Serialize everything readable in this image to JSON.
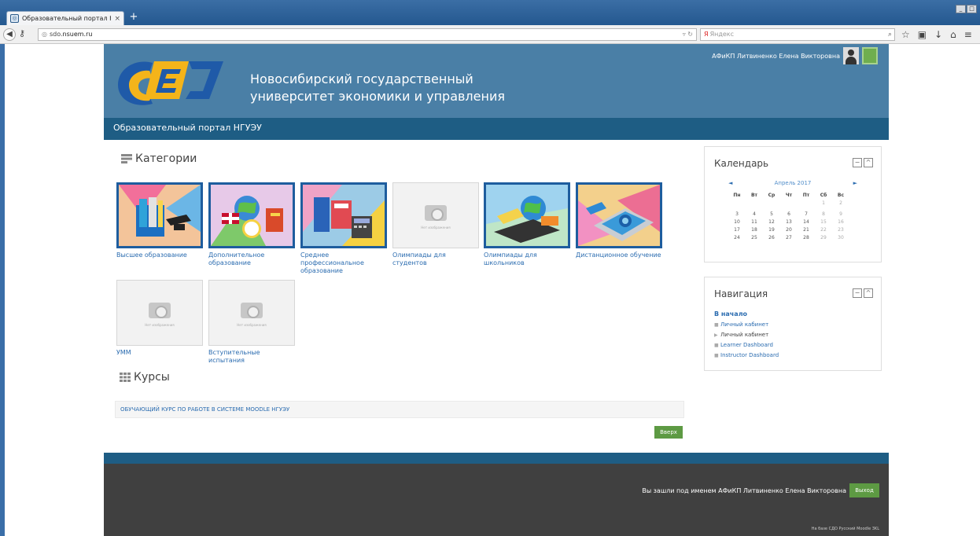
{
  "browser": {
    "tab_title": "Образовательный портал Н...",
    "tab_close": "×",
    "new_tab": "+",
    "url_prefix": "sdo.",
    "url_host": "nsuem.ru",
    "search_placeholder": "Яндекс",
    "favicon": "globe-icon"
  },
  "header": {
    "uni_line1": "Новосибирский государственный",
    "uni_line2": "университет экономики и управления",
    "user_name": "АФиКП Литвиненко Елена Викторовна",
    "portal_title": "Образовательный портал НГУЭУ",
    "logo_colors": [
      "#f4b41a",
      "#1f5aa8",
      "#ffffff"
    ]
  },
  "categories": {
    "heading": "Категории",
    "noimage_text": "Нет изображения",
    "items": [
      {
        "label": "Высшее образование",
        "has_image": true
      },
      {
        "label": "Дополнительное образование",
        "has_image": true
      },
      {
        "label": "Среднее профессиональное образование",
        "has_image": true
      },
      {
        "label": "Олимпиады для студентов",
        "has_image": false
      },
      {
        "label": "Олимпиады для школьников",
        "has_image": true
      },
      {
        "label": "Дистанционное обучение",
        "has_image": true
      },
      {
        "label": "УММ",
        "has_image": false
      },
      {
        "label": "Вступительные испытания",
        "has_image": false
      }
    ]
  },
  "courses": {
    "heading": "Курсы",
    "items": [
      "ОБУЧАЮЩИЙ КУРС ПО РАБОТЕ В СИСТЕМЕ MOODLE НГУЭУ"
    ],
    "top_button": "Вверх"
  },
  "calendar": {
    "title": "Календарь",
    "month": "Апрель 2017",
    "weekdays": [
      "Пн",
      "Вт",
      "Ср",
      "Чт",
      "Пт",
      "Сб",
      "Вс"
    ],
    "weeks": [
      [
        "",
        "",
        "",
        "",
        "",
        "1",
        "2"
      ],
      [
        "3",
        "4",
        "5",
        "6",
        "7",
        "8",
        "9"
      ],
      [
        "10",
        "11",
        "12",
        "13",
        "14",
        "15",
        "16"
      ],
      [
        "17",
        "18",
        "19",
        "20",
        "21",
        "22",
        "23"
      ],
      [
        "24",
        "25",
        "26",
        "27",
        "28",
        "29",
        "30"
      ]
    ]
  },
  "navigation": {
    "title": "Навигация",
    "home": "В начало",
    "items": [
      {
        "label": "Личный кабинет",
        "bullet": "■",
        "linked": true
      },
      {
        "label": "Личный кабинет",
        "bullet": "▶",
        "linked": false
      },
      {
        "label": "Learner Dashboard",
        "bullet": "■",
        "linked": true
      },
      {
        "label": "Instructor Dashboard",
        "bullet": "■",
        "linked": true
      }
    ]
  },
  "footer": {
    "logged_in_as": "Вы зашли под именем АФиКП Литвиненко Елена Викторовна",
    "logout": "Выход",
    "powered_by": "На базе СДО Русский Moodle 3KL"
  },
  "colors": {
    "header": "#4a7fa6",
    "subbar": "#1e5d84",
    "footer": "#404040",
    "accent_green": "#5d9a43",
    "link": "#2b6cb0"
  }
}
